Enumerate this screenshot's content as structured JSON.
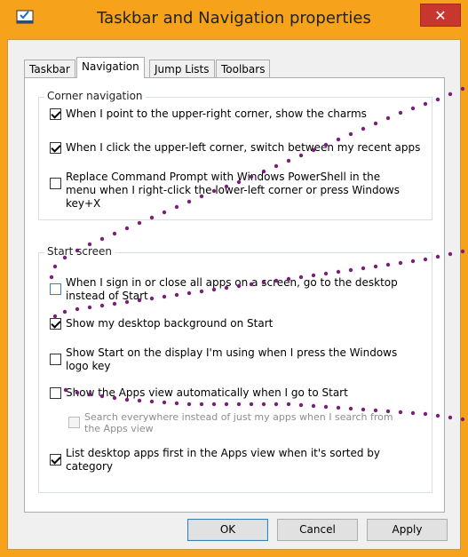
{
  "window": {
    "title": "Taskbar and Navigation properties",
    "close_glyph": "✕"
  },
  "tabs": [
    {
      "label": "Taskbar",
      "active": false
    },
    {
      "label": "Navigation",
      "active": true
    },
    {
      "label": "Jump Lists",
      "active": false
    },
    {
      "label": "Toolbars",
      "active": false
    }
  ],
  "corner_navigation": {
    "legend": "Corner navigation",
    "options": [
      {
        "label": "When I point to the upper-right corner, show the charms",
        "checked": true
      },
      {
        "label": "When I click the upper-left corner, switch between my recent apps",
        "checked": true
      },
      {
        "label": "Replace Command Prompt with Windows PowerShell in the menu when I right-click the lower-left corner or press Windows key+X",
        "checked": false
      }
    ]
  },
  "start_screen": {
    "legend": "Start screen",
    "options": [
      {
        "label": "When I sign in or close all apps on a screen, go to the desktop instead of Start",
        "checked": false
      },
      {
        "label": "Show my desktop background on Start",
        "checked": true
      },
      {
        "label": "Show Start on the display I'm using when I press the Windows logo key",
        "checked": false
      },
      {
        "label": "Show the Apps view automatically when I go to Start",
        "checked": false
      },
      {
        "label": "Search everywhere instead of just my apps when I search from the Apps view",
        "checked": false,
        "disabled": true
      },
      {
        "label": "List desktop apps first in the Apps view when it's sorted by category",
        "checked": true
      }
    ]
  },
  "buttons": {
    "ok": "OK",
    "cancel": "Cancel",
    "apply": "Apply"
  },
  "colors": {
    "frame": "#f6a21a",
    "close": "#c7372f",
    "annotation_dots": "#7a1f7a"
  }
}
